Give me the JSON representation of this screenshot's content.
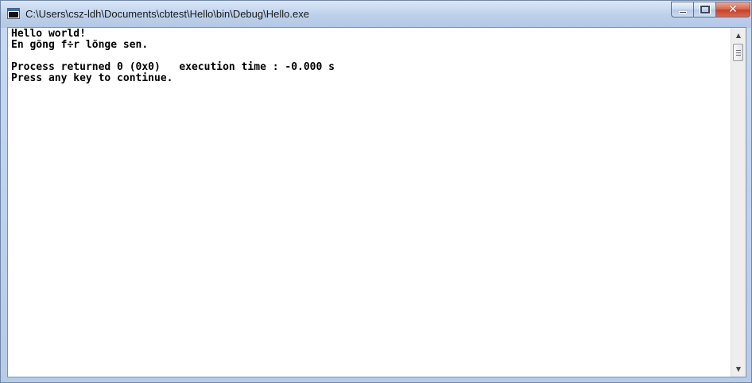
{
  "window": {
    "title": "C:\\Users\\csz-ldh\\Documents\\cbtest\\Hello\\bin\\Debug\\Hello.exe",
    "close_symbol": "✕"
  },
  "console": {
    "lines": [
      "Hello world!",
      "En gõng f÷r lõnge sen.",
      "",
      "Process returned 0 (0x0)   execution time : -0.000 s",
      "Press any key to continue."
    ]
  },
  "scrollbar": {
    "up_arrow": "▲",
    "down_arrow": "▼"
  },
  "icons": [
    "console-app-icon",
    "minimize-icon",
    "maximize-icon",
    "close-icon",
    "scroll-up-icon",
    "scroll-down-icon",
    "scroll-thumb-grip-icon"
  ]
}
